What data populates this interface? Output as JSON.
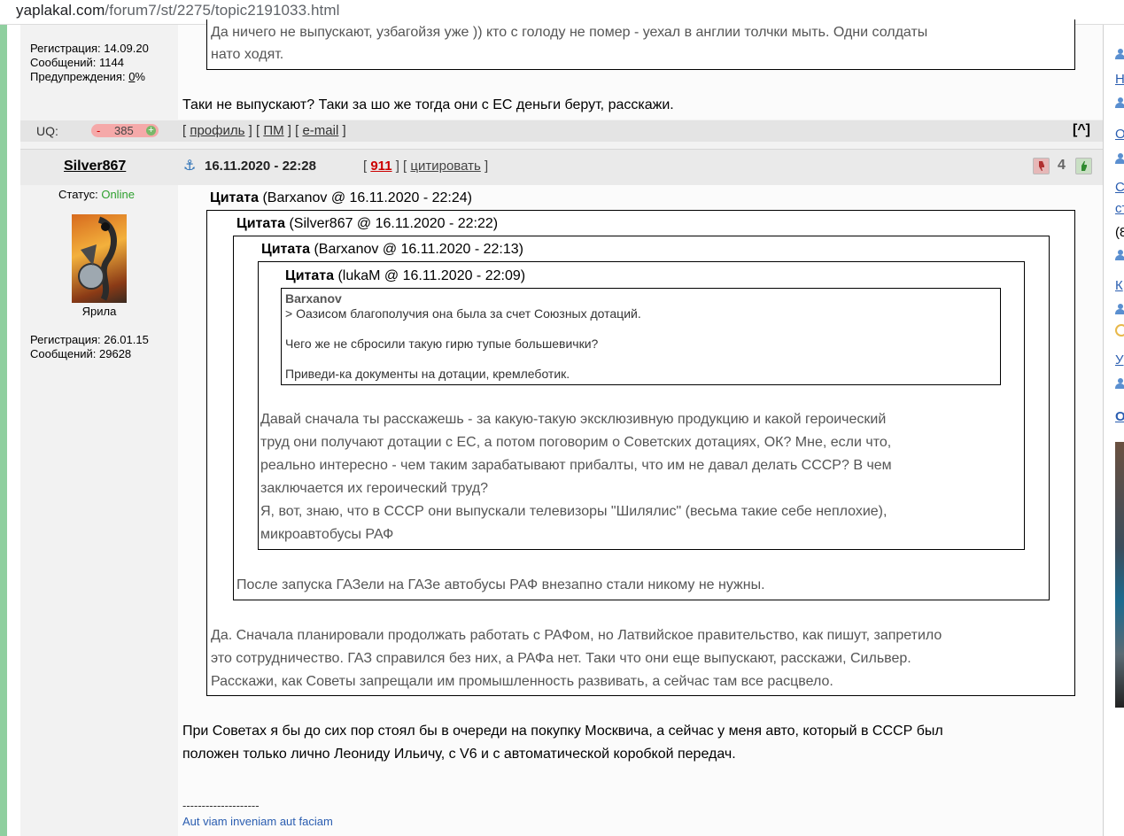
{
  "browser": {
    "url_host": "yaplakal.com",
    "url_path": "/forum7/st/2275/topic2191033.html"
  },
  "prev_post": {
    "reg_label": "Регистрация: 14.09.20",
    "posts_label": "Сообщений: 1144",
    "warn_prefix": "Предупреждения: ",
    "warn_value": "0",
    "warn_suffix": "%",
    "quote_line1": "Да ничего не выпускают, узбагойзя уже )) кто с голоду не помер - уехал в англии толчки мыть. Одни солдаты",
    "quote_line2": "нато ходят.",
    "reply": "Таки не выпускают? Таки за шо же тогда они с ЕС деньги берут, расскажи.",
    "uq_label": "UQ:",
    "uq_minus": "-",
    "uq_value": "385",
    "uq_plus": "+",
    "links": {
      "open": "[",
      "profile": "профиль",
      "sep1": "] [",
      "pm": "ПМ",
      "sep2": "] [",
      "email": "e-mail",
      "close": "]"
    },
    "top_link": "[^]"
  },
  "post": {
    "author": "Silver867",
    "status_label": "Статус:",
    "status_value": "Online",
    "avatar_caption": "Ярила",
    "reg_label": "Регистрация: 26.01.15",
    "posts_label": "Сообщений: 29628",
    "anchor_icon": "⚓",
    "date": "16.11.2020 - 22:28",
    "num_open": "[",
    "num": "911",
    "num_mid": "] [",
    "cite": "цитировать",
    "num_close": "]",
    "rating": "4",
    "quote1_label": "Цитата",
    "quote1_meta": "(Barxanov @ 16.11.2020 - 22:24)",
    "quote2_label": "Цитата",
    "quote2_meta": "(Silver867 @ 16.11.2020 - 22:22)",
    "quote3_label": "Цитата",
    "quote3_meta": "(Barxanov @ 16.11.2020 - 22:13)",
    "quote4_label": "Цитата",
    "quote4_meta": "(lukaM @ 16.11.2020 - 22:09)",
    "quote4_author": "Barxanov",
    "quote4_lines": [
      "> Оазисом благополучия она была за счет Союзных дотаций.",
      "Чего же не сбросили такую гирю тупые большевички?",
      "Приведи-ка документы на дотации, кремлеботик."
    ],
    "quote3_lines": [
      "Давай сначала ты расскажешь - за какую-такую эксклюзивную продукцию и какой героический",
      "труд они получают дотации с ЕС, а потом поговорим о Советских дотациях, ОК? Мне, если что,",
      "реально интересно - чем таким зарабатывают прибалты, что им не давал делать СССР? В чем",
      "заключается их героический труд?",
      "Я, вот, знаю, что в СССР они выпускали телевизоры \"Шилялис\" (весьма такие себе неплохие),",
      "микроавтобусы РАФ"
    ],
    "quote2_text": "После запуска ГАЗели на ГАЗе автобусы РАФ внезапно стали никому не нужны.",
    "quote1_lines": [
      "Да. Сначала планировали продолжать работать с РАФом, но Латвийское правительство, как пишут, запретило",
      "это сотрудничество. ГАЗ справился без них, а РАФа нет. Таки что они еще выпускают, расскажи, Сильвер.",
      "Расскажи, как Советы запрещали им промышленность развивать, а сейчас там все расцвело."
    ],
    "reply_lines": [
      "При Советах я бы до сих пор стоял бы в очереди на покупку Москвича, а сейчас у меня авто, который в СССР был",
      "положен только лично Леониду Ильичу, с V6 и с автоматической коробкой передач."
    ],
    "sig_dashes": "--------------------",
    "signature": "Aut viam inveniam aut faciam"
  },
  "right_column": {
    "links": [
      "Н",
      "О",
      "С",
      "ст",
      "К",
      "У",
      "О"
    ],
    "text_8": "(8"
  },
  "colors": {
    "accent_link": "#2a5db0",
    "online": "#2ea02e",
    "post_number": "#cc0000",
    "strip": "#8fcf9f"
  }
}
